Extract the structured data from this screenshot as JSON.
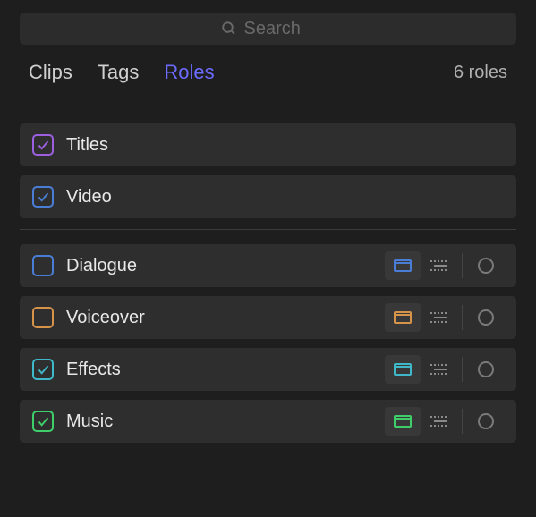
{
  "search": {
    "placeholder": "Search"
  },
  "tabs": {
    "clips": "Clips",
    "tags": "Tags",
    "roles": "Roles"
  },
  "roles_count": "6 roles",
  "video_roles": [
    {
      "label": "Titles",
      "checked": true,
      "color": "#9b5fe0"
    },
    {
      "label": "Video",
      "checked": true,
      "color": "#4a7dd6"
    }
  ],
  "audio_roles": [
    {
      "label": "Dialogue",
      "checked": false,
      "color": "#4a7dd6"
    },
    {
      "label": "Voiceover",
      "checked": false,
      "color": "#d6934a"
    },
    {
      "label": "Effects",
      "checked": true,
      "color": "#3fb8c9"
    },
    {
      "label": "Music",
      "checked": true,
      "color": "#3fcf6a"
    }
  ]
}
